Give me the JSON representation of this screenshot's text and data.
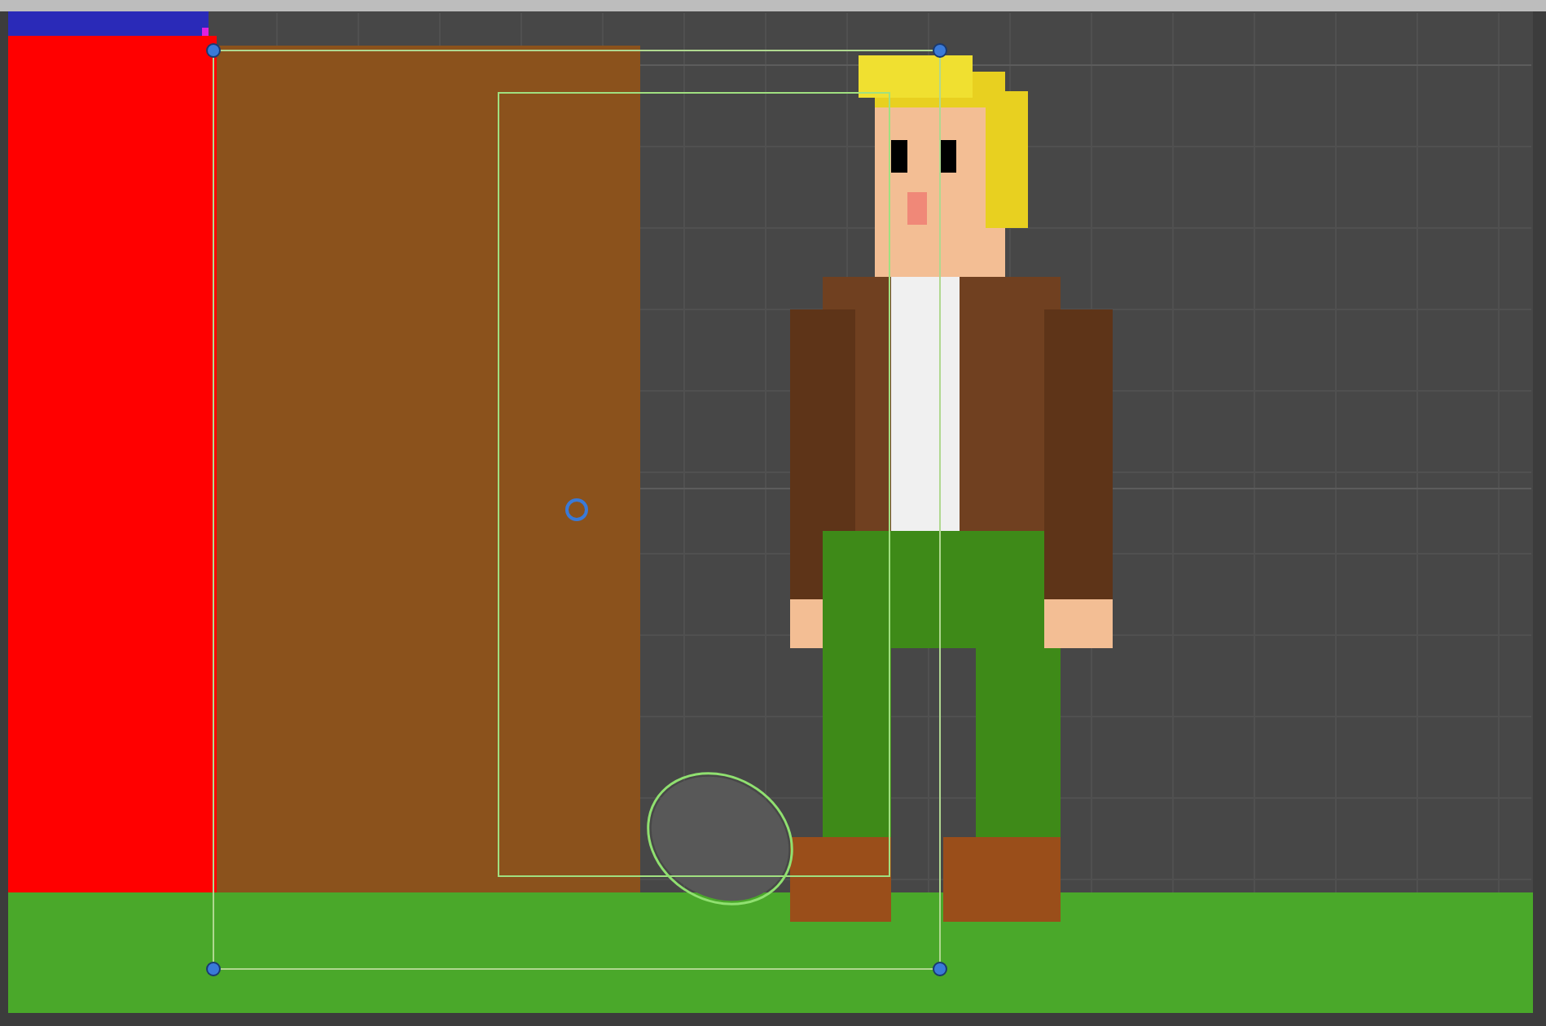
{
  "scene": {
    "grid": true,
    "selection_gizmo": true,
    "colliders": true
  }
}
